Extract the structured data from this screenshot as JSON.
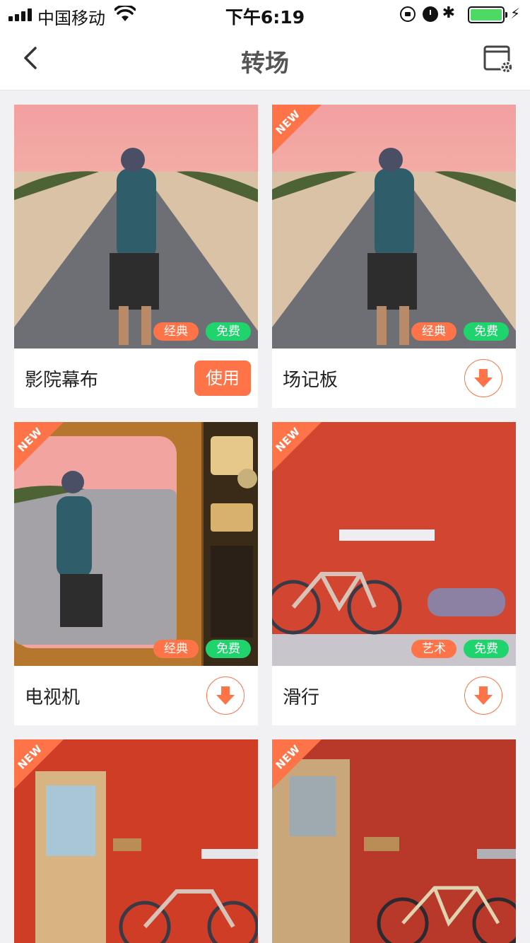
{
  "status_bar": {
    "carrier": "中国移动",
    "time": "下午6:19",
    "bluetooth_glyph": "✱",
    "charge_glyph": "⚡"
  },
  "nav": {
    "title": "转场",
    "back_icon": "chevron-left-icon",
    "settings_icon": "window-settings-icon"
  },
  "colors": {
    "accent": "#ff7349",
    "free_tag": "#1fd46d",
    "background": "#f1f1f3"
  },
  "cards": [
    {
      "name": "影院幕布",
      "category_tag": "经典",
      "price_tag": "免费",
      "is_new": false,
      "action": "use",
      "action_label": "使用",
      "scene": "road"
    },
    {
      "name": "场记板",
      "category_tag": "经典",
      "price_tag": "免费",
      "is_new": true,
      "new_label": "NEW",
      "action": "download",
      "scene": "road"
    },
    {
      "name": "电视机",
      "category_tag": "经典",
      "price_tag": "免费",
      "is_new": true,
      "new_label": "NEW",
      "action": "download",
      "scene": "tv"
    },
    {
      "name": "滑行",
      "category_tag": "艺术",
      "price_tag": "免费",
      "is_new": true,
      "new_label": "NEW",
      "action": "download",
      "scene": "bike-wall"
    },
    {
      "is_new": true,
      "new_label": "NEW",
      "scene": "door-wall-blur"
    },
    {
      "is_new": true,
      "new_label": "NEW",
      "scene": "door-wall"
    }
  ]
}
